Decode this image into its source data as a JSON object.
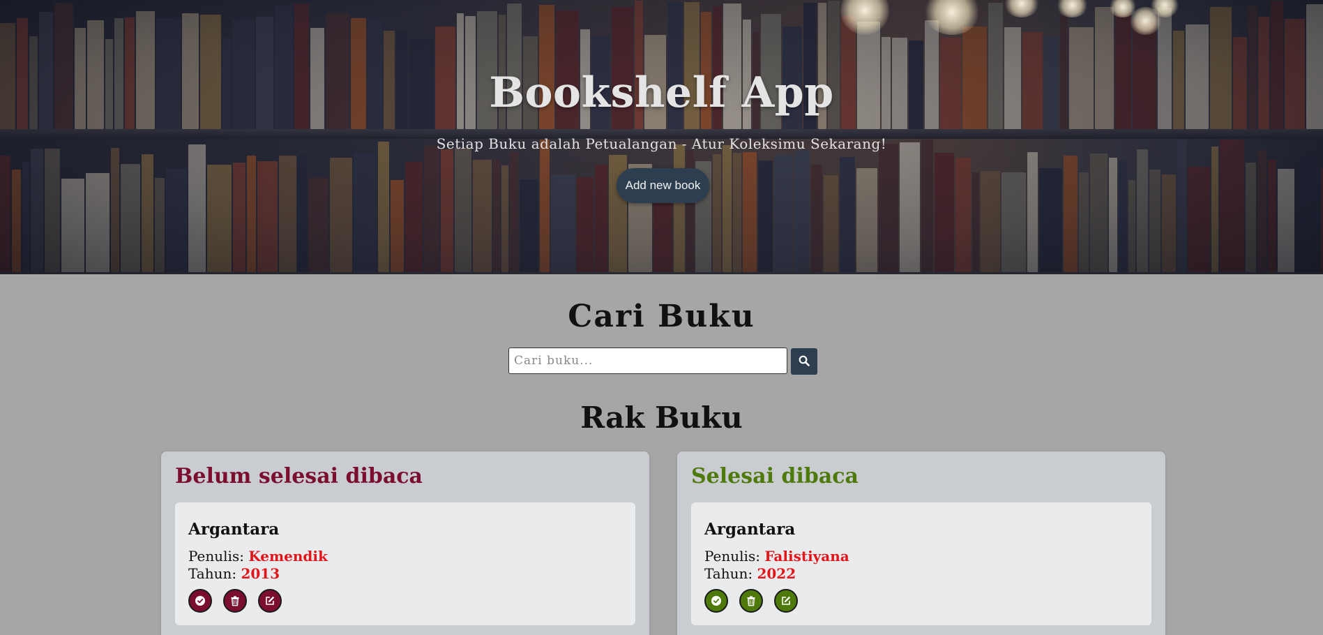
{
  "hero": {
    "title": "Bookshelf App",
    "subtitle": "Setiap Buku adalah Petualangan - Atur Koleksimu Sekarang!",
    "add_button_label": "Add new book"
  },
  "search": {
    "title": "Cari Buku",
    "placeholder": "Cari buku...",
    "value": "",
    "button_icon": "search-icon"
  },
  "bookshelf": {
    "title": "Rak Buku",
    "unfinished": {
      "title": "Belum selesai dibaca",
      "accent": "#7b0d2e",
      "books": [
        {
          "title": "Argantara",
          "author_label": "Penulis:",
          "author": "Kemendik",
          "year_label": "Tahun:",
          "year": "2013"
        }
      ]
    },
    "finished": {
      "title": "Selesai dibaca",
      "accent": "#4e7a0c",
      "books": [
        {
          "title": "Argantara",
          "author_label": "Penulis:",
          "author": "Falistiyana",
          "year_label": "Tahun:",
          "year": "2022"
        }
      ]
    },
    "action_icons": [
      "check-circle-icon",
      "trash-icon",
      "edit-icon"
    ]
  },
  "colors": {
    "primary": "#2c3e50",
    "value_highlight": "#e0161b",
    "page_background": "#a6a6a6"
  }
}
